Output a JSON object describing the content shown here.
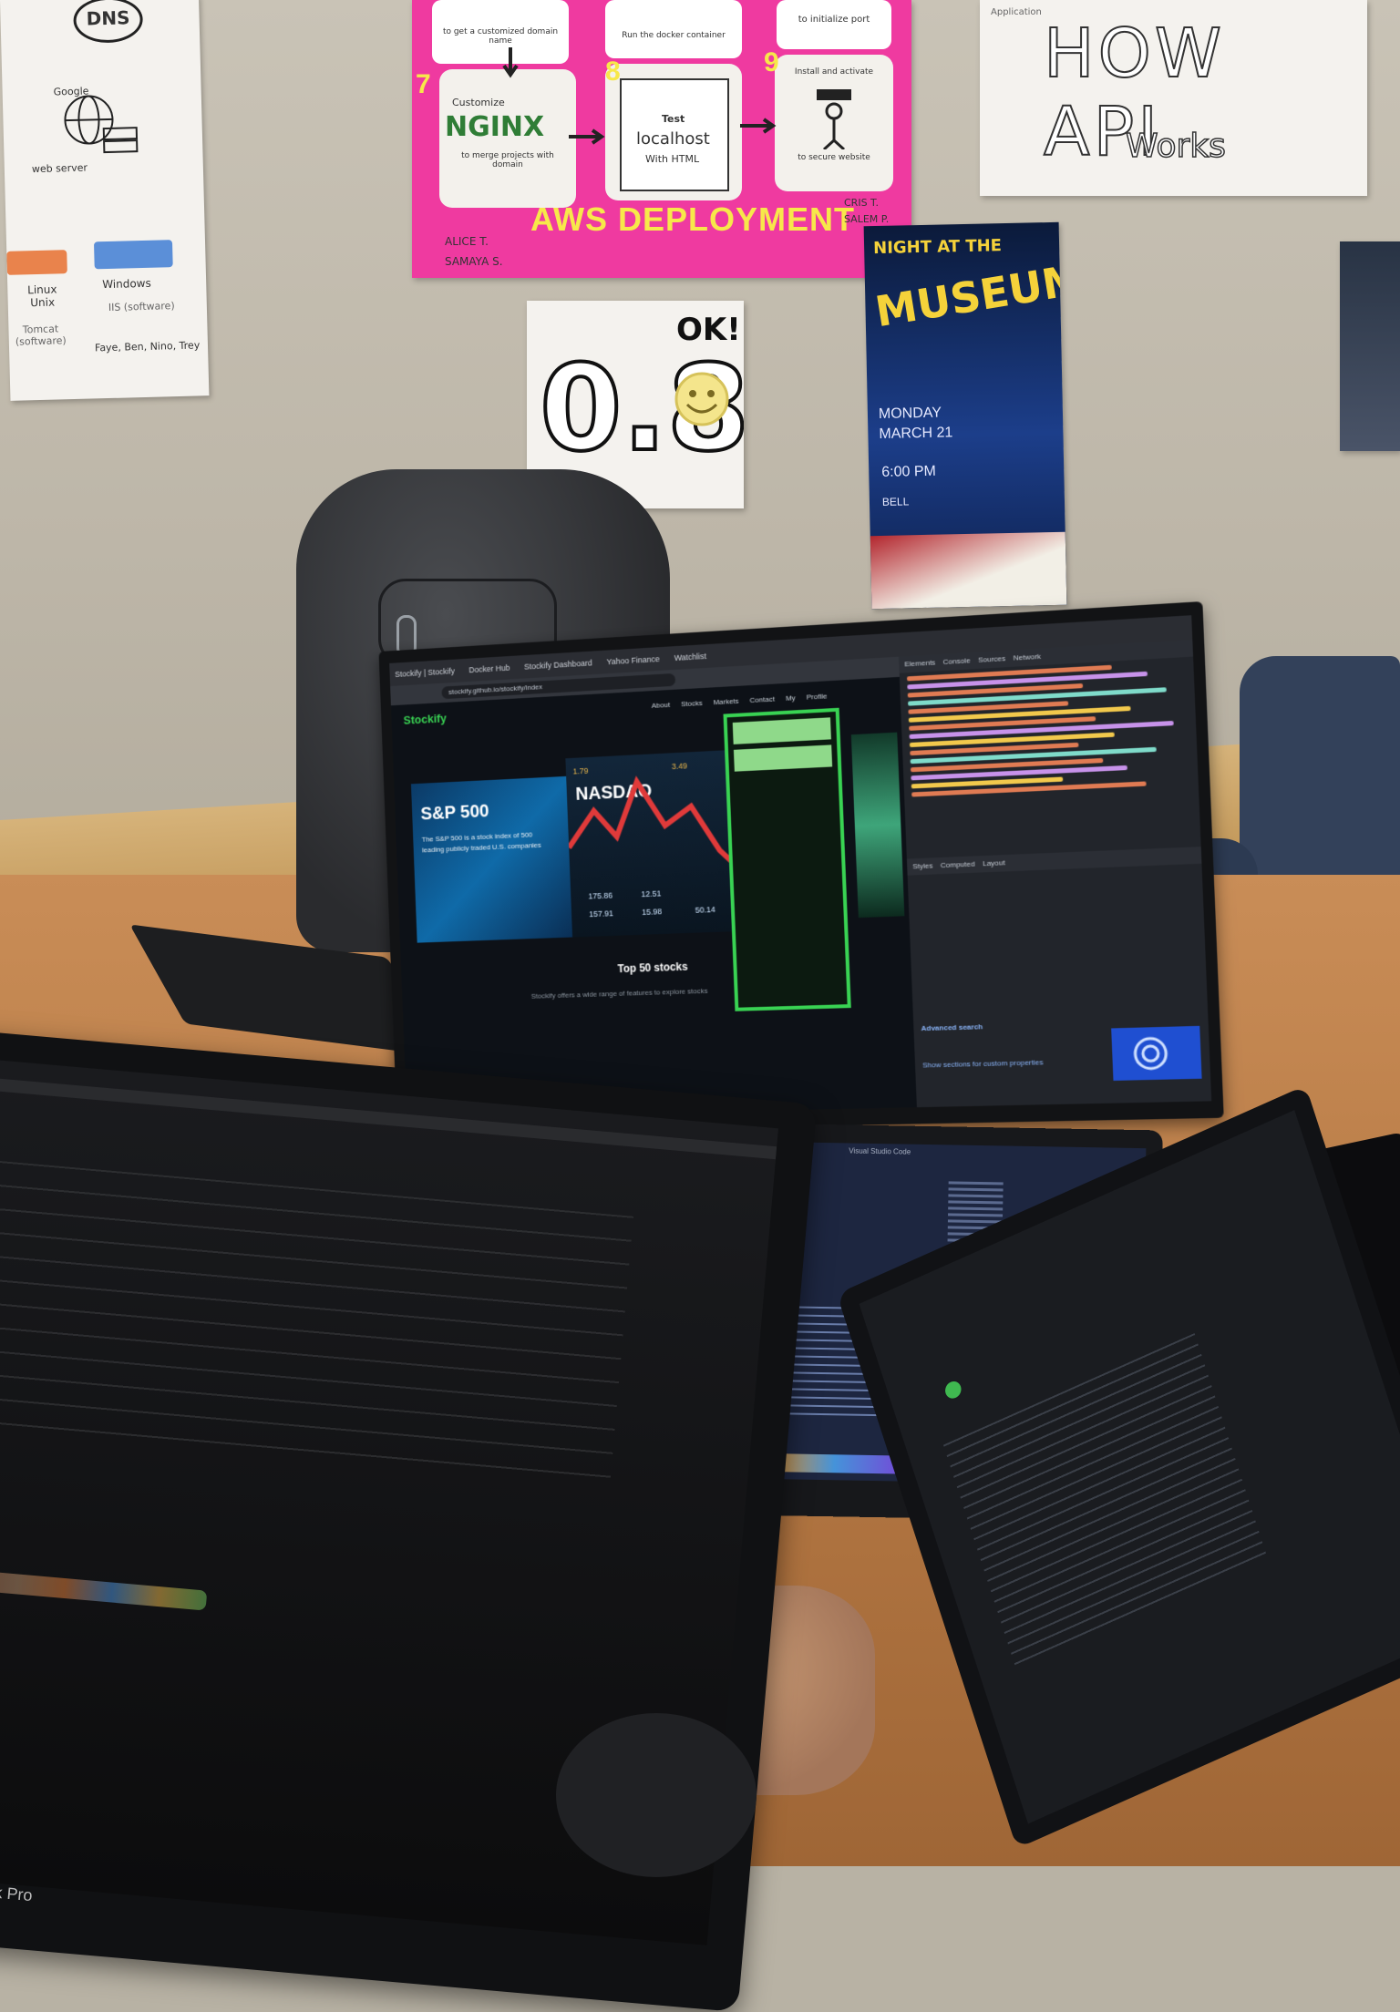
{
  "posters": {
    "dns": {
      "header": "DNS",
      "caption_google": "Google",
      "caption_server": "web server",
      "linux_label": "Linux Unix",
      "linux_software": "Tomcat (software)",
      "windows_label": "Windows",
      "windows_software": "IIS (software)",
      "credits": "Faye, Ben, Nino, Trey"
    },
    "aws": {
      "step1_text": "to get a customized domain name",
      "step2_text": "Run the docker container",
      "step3_text": "to initialize port",
      "step7_number": "7",
      "step7_brand": "NGINX",
      "step7_title": "Customize",
      "step7_text": "to merge projects with domain",
      "step8_number": "8",
      "step8_title": "Test",
      "step8_host": "localhost",
      "step8_text": "With HTML",
      "step9_number": "9",
      "step9_title": "Install and activate",
      "step9_text": "to secure website",
      "title": "AWS DEPLOYMENT",
      "credits_left": "ALICE T. SAMAYA S.",
      "credits_right": "CRIS T. SALEM P."
    },
    "api": {
      "tag": "Application",
      "title": "HOW API",
      "subtitle": "Works"
    },
    "ok": {
      "value": "0.8",
      "label": "OK!"
    },
    "museum": {
      "title_line1": "NIGHT AT THE",
      "title_line2": "MUSEUM!",
      "date": "MONDAY MARCH 21",
      "time": "6:00 PM",
      "place": "BELL"
    }
  },
  "monitor": {
    "app_name": "Stockify",
    "tabs": [
      "Stockify | Stockify",
      "Docker Hub",
      "Stockify Dashboard",
      "Yahoo Finance",
      "Watchlist"
    ],
    "url": "stockify.github.io/stockify/index",
    "nav": [
      "About",
      "Stocks",
      "Markets",
      "Contact",
      "My Profile"
    ],
    "hero": {
      "sp500_title": "S&P 500",
      "sp500_text": "The S&P 500 is a stock index of 500 leading publicly traded U.S. companies",
      "nasdaq_title": "NASDAQ",
      "numbers": [
        "1.79",
        "3.49",
        "175.86",
        "12.51",
        "157.91",
        "15.98",
        "50.14"
      ]
    },
    "section_title": "Top 50 stocks",
    "section_text": "Stockify offers a wide range of features to explore stocks",
    "devtools": {
      "tabs": [
        "Elements",
        "Console",
        "Sources",
        "Network"
      ],
      "subtabs": [
        "Styles",
        "Computed",
        "Layout"
      ],
      "section_label": "Advanced search",
      "hint": "Show sections for custom properties"
    }
  },
  "laptop_mid": {
    "window_title": "Visual Studio Code"
  },
  "laptop_left": {
    "brand": "MacBook Pro"
  },
  "colors": {
    "pink_poster": "#ef3aa0",
    "aws_title": "#f7e84a",
    "stockify_green": "#39d353",
    "nasdaq_red": "#e03a3a",
    "wall": "#c9c3b6",
    "desk": "#c98d57"
  }
}
